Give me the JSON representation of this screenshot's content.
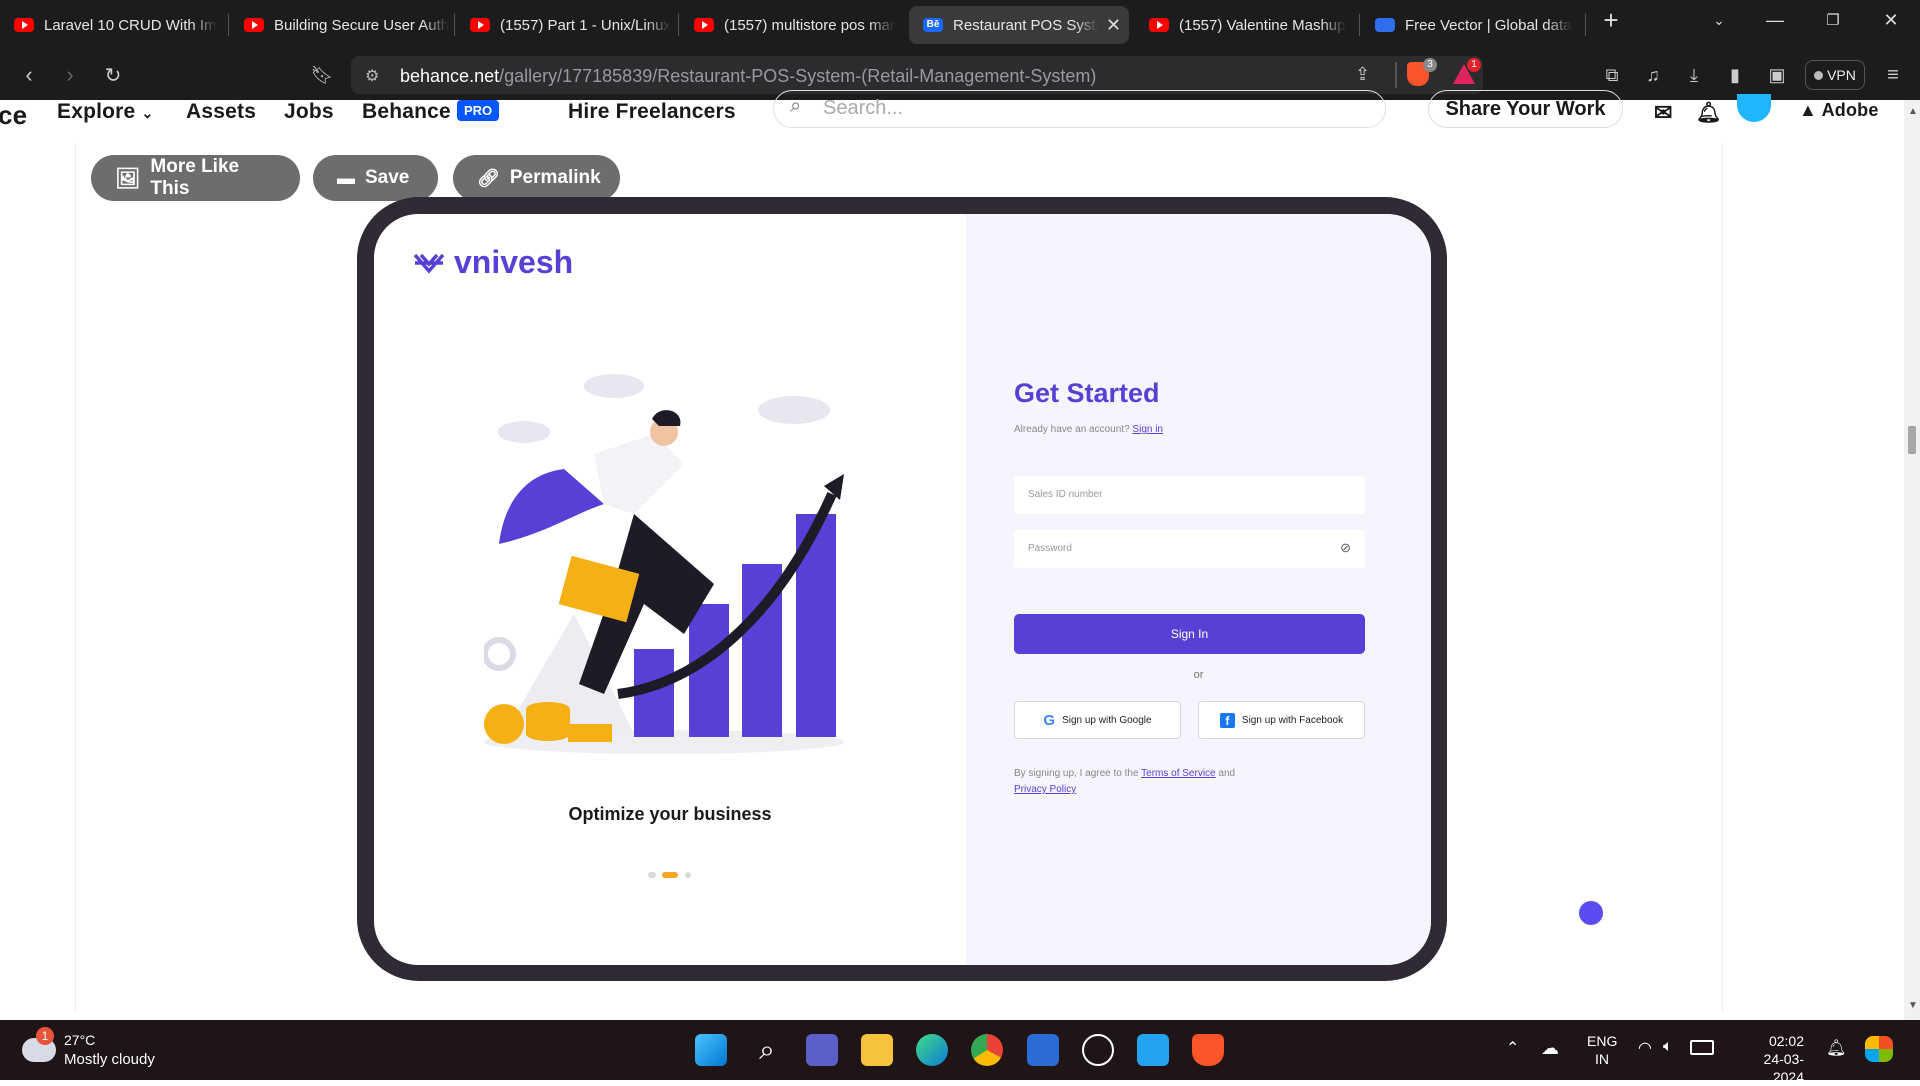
{
  "browser": {
    "tabs": [
      {
        "label": "Laravel 10 CRUD With Im",
        "icon": "youtube-icon",
        "active": false
      },
      {
        "label": "Building Secure User Auth",
        "icon": "youtube-icon",
        "active": false
      },
      {
        "label": "(1557) Part 1 - Unix/Linux",
        "icon": "youtube-icon",
        "active": false
      },
      {
        "label": "(1557) multistore pos mar",
        "icon": "youtube-icon",
        "active": false
      },
      {
        "label": "Restaurant POS Syste",
        "icon": "behance-icon",
        "active": true
      },
      {
        "label": "(1557) Valentine Mashup",
        "icon": "youtube-icon",
        "active": false
      },
      {
        "label": "Free Vector | Global data",
        "icon": "freepik-icon",
        "active": false
      }
    ],
    "url_host": "behance.net",
    "url_path": "/gallery/177185839/Restaurant-POS-System-(Retail-Management-System)",
    "brave_shield_count": "3",
    "brave_rewards_count": "1",
    "vpn_label": "VPN"
  },
  "behance": {
    "logo_fragment": "ce",
    "nav": {
      "explore": "Explore",
      "assets": "Assets",
      "jobs": "Jobs",
      "behance": "Behance",
      "pro": "PRO",
      "hire": "Hire Freelancers"
    },
    "search_placeholder": "Search...",
    "share_label": "Share Your Work",
    "adobe_label": "Adobe",
    "actions": {
      "more": "More Like This",
      "save": "Save",
      "permalink": "Permalink"
    }
  },
  "design": {
    "brand": "vnivesh",
    "tagline": "Optimize your business",
    "get_started": "Get Started",
    "already_text": "Already have an account?",
    "sign_in_link": "Sign in",
    "sales_id_placeholder": "Sales ID number",
    "password_placeholder": "Password",
    "sign_in_button": "Sign In",
    "or": "or",
    "google_button": "Sign up with Google",
    "facebook_button": "Sign up with Facebook",
    "terms_prefix": "By signing up, I agree to the",
    "terms_link": "Terms of Service",
    "terms_and": "and",
    "privacy_link": "Privacy Policy",
    "accent_color": "#5a3fd6"
  },
  "taskbar": {
    "weather_badge": "1",
    "temperature": "27°C",
    "weather": "Mostly cloudy",
    "lang_top": "ENG",
    "lang_bottom": "IN",
    "time": "02:02",
    "date": "24-03-2024"
  }
}
